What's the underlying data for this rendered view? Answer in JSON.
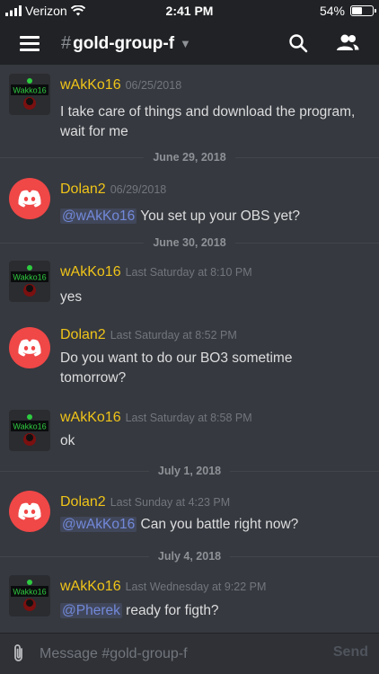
{
  "status_bar": {
    "carrier": "Verizon",
    "time": "2:41 PM",
    "battery": "54%",
    "battery_level": 0.54
  },
  "header": {
    "channel": "gold-group-f"
  },
  "messages": [
    {
      "author": "wAkKo16",
      "timestamp": "06/25/2018",
      "text": "I take care of things and download the program, wait for me",
      "avatar_label": "Wakko16"
    },
    {
      "author": "Dolan2",
      "timestamp": "06/29/2018",
      "mention": "@wAkKo16",
      "text": " You set up your OBS yet?"
    },
    {
      "author": "wAkKo16",
      "timestamp": "Last Saturday at 8:10 PM",
      "text": "yes",
      "avatar_label": "Wakko16"
    },
    {
      "author": "Dolan2",
      "timestamp": "Last Saturday at 8:52 PM",
      "text": "Do you want to do our BO3 sometime tomorrow?"
    },
    {
      "author": "wAkKo16",
      "timestamp": "Last Saturday at 8:58 PM",
      "text": "ok",
      "avatar_label": "Wakko16"
    },
    {
      "author": "Dolan2",
      "timestamp": "Last Sunday at 4:23 PM",
      "mention": "@wAkKo16",
      "text": " Can you battle right now?"
    },
    {
      "author": "wAkKo16",
      "timestamp": "Last Wednesday at 9:22 PM",
      "mention": "@Pherek",
      "text": " ready for figth?",
      "avatar_label": "Wakko16"
    }
  ],
  "dividers": [
    "June 29, 2018",
    "June 30, 2018",
    "July 1, 2018",
    "July 4, 2018"
  ],
  "composer": {
    "placeholder": "Message #gold-group-f",
    "send_label": "Send"
  },
  "colors": {
    "background": "#36393f",
    "header": "#202225",
    "author": "#f0c419",
    "mention": "#7289da",
    "discord_red": "#f04747"
  }
}
